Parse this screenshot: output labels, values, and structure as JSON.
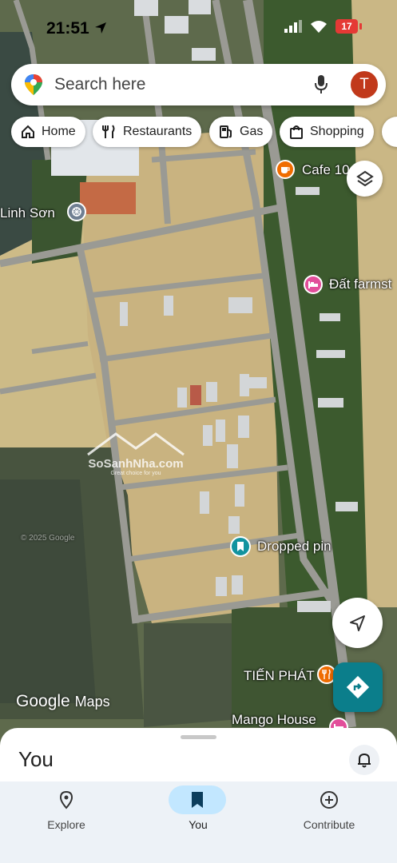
{
  "status_bar": {
    "time": "21:51",
    "battery": "17"
  },
  "search": {
    "placeholder": "Search here",
    "avatar_letter": "T"
  },
  "chips": [
    {
      "label": "Home",
      "icon": "home-icon"
    },
    {
      "label": "Restaurants",
      "icon": "fork-knife-icon"
    },
    {
      "label": "Gas",
      "icon": "gas-pump-icon"
    },
    {
      "label": "Shopping",
      "icon": "shopping-bag-icon"
    }
  ],
  "map": {
    "places": {
      "cafe": "Cafe 10",
      "temple": "Linh Sơn",
      "farmstay": "Đất farmst",
      "dropped_pin": "Dropped pin",
      "tien_phat": "TIẾN PHÁT",
      "mango_house": "Mango House"
    },
    "watermark": "SoSanhNha.com",
    "watermark_sub": "Great choice for you",
    "attribution": "© 2025 Google",
    "brand_google": "Google",
    "brand_maps": "Maps"
  },
  "sheet": {
    "title": "You"
  },
  "bottom_nav": [
    {
      "label": "Explore",
      "icon": "location-pin-icon",
      "active": false
    },
    {
      "label": "You",
      "icon": "bookmark-icon",
      "active": true
    },
    {
      "label": "Contribute",
      "icon": "add-circle-icon",
      "active": false
    }
  ],
  "colors": {
    "accent": "#0b7e8b",
    "avatar": "#c1391b",
    "nav_active_bg": "#c2e7ff",
    "battery": "#e53935"
  }
}
